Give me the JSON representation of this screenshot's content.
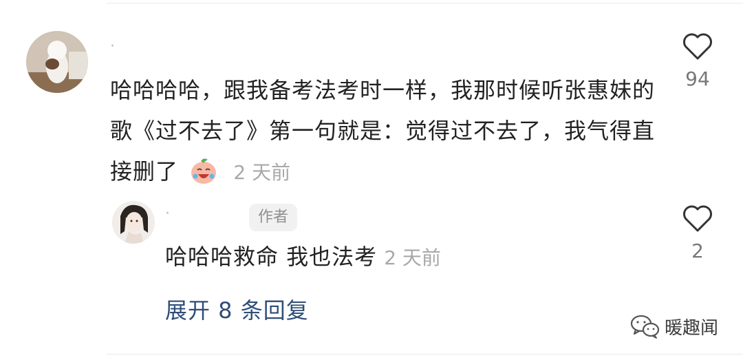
{
  "comment": {
    "username": "·",
    "text": "哈哈哈哈，跟我备考法考时一样，我那时候听张惠妹的歌《过不去了》第一句就是：觉得过不去了，我气得直接删了",
    "emoji": "crying-laughing-peach-emoji",
    "time": "2 天前",
    "like_count": "94",
    "icons": {
      "like": "heart-outline-icon"
    }
  },
  "reply": {
    "username": "·",
    "badge": "作者",
    "text": "哈哈哈救命 我也法考",
    "time": "2 天前",
    "like_count": "2",
    "icons": {
      "like": "heart-outline-icon"
    }
  },
  "expand_replies": "展开 8 条回复",
  "watermark": {
    "icon": "wechat-icon",
    "text": "暖趣闻"
  },
  "colors": {
    "link": "#2f4d78",
    "text": "#222222",
    "meta": "#a8a8a8"
  }
}
